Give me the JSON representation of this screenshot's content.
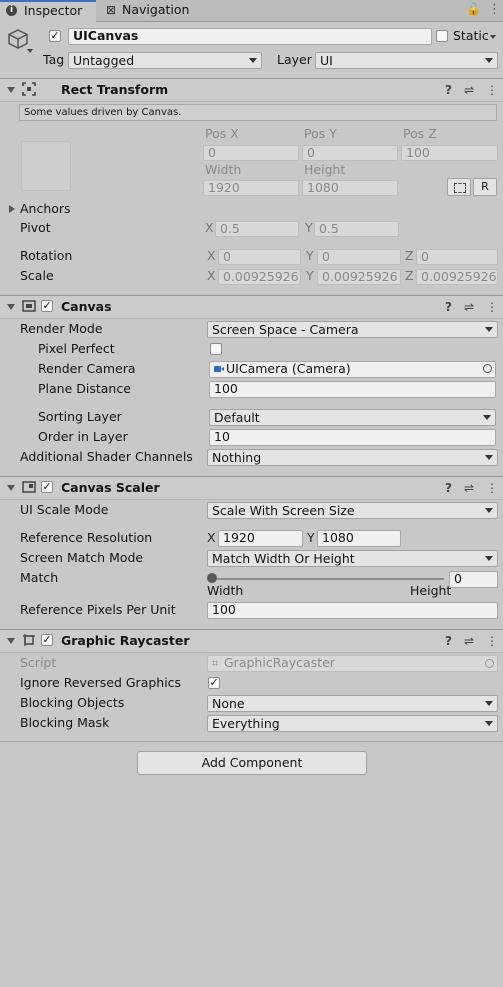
{
  "tabs": {
    "inspector": "Inspector",
    "navigation": "Navigation"
  },
  "object": {
    "name": "UICanvas",
    "static_label": "Static",
    "tag_label": "Tag",
    "tag_value": "Untagged",
    "layer_label": "Layer",
    "layer_value": "UI"
  },
  "rect_transform": {
    "title": "Rect Transform",
    "info": "Some values driven by Canvas.",
    "pos_x_label": "Pos X",
    "pos_y_label": "Pos Y",
    "pos_z_label": "Pos Z",
    "pos_x": "0",
    "pos_y": "0",
    "pos_z": "100",
    "width_label": "Width",
    "height_label": "Height",
    "width": "1920",
    "height": "1080",
    "r_button": "R",
    "anchors_label": "Anchors",
    "pivot_label": "Pivot",
    "pivot_x": "0.5",
    "pivot_y": "0.5",
    "rotation_label": "Rotation",
    "rot_x": "0",
    "rot_y": "0",
    "rot_z": "0",
    "scale_label": "Scale",
    "scale_x": "0.00925926",
    "scale_y": "0.00925926",
    "scale_z": "0.00925926",
    "axis_x": "X",
    "axis_y": "Y",
    "axis_z": "Z"
  },
  "canvas": {
    "title": "Canvas",
    "render_mode_label": "Render Mode",
    "render_mode": "Screen Space - Camera",
    "pixel_perfect_label": "Pixel Perfect",
    "render_camera_label": "Render Camera",
    "render_camera": "UICamera (Camera)",
    "plane_distance_label": "Plane Distance",
    "plane_distance": "100",
    "sorting_layer_label": "Sorting Layer",
    "sorting_layer": "Default",
    "order_label": "Order in Layer",
    "order": "10",
    "shader_channels_label": "Additional Shader Channels",
    "shader_channels": "Nothing"
  },
  "canvas_scaler": {
    "title": "Canvas Scaler",
    "scale_mode_label": "UI Scale Mode",
    "scale_mode": "Scale With Screen Size",
    "ref_res_label": "Reference Resolution",
    "ref_x": "1920",
    "ref_y": "1080",
    "axis_x": "X",
    "axis_y": "Y",
    "match_mode_label": "Screen Match Mode",
    "match_mode": "Match Width Or Height",
    "match_label": "Match",
    "match_value": "0",
    "match_fraction": 0,
    "width_caption": "Width",
    "height_caption": "Height",
    "ppu_label": "Reference Pixels Per Unit",
    "ppu": "100"
  },
  "raycaster": {
    "title": "Graphic Raycaster",
    "script_label": "Script",
    "script": "GraphicRaycaster",
    "ignore_reversed_label": "Ignore Reversed Graphics",
    "blocking_objects_label": "Blocking Objects",
    "blocking_objects": "None",
    "blocking_mask_label": "Blocking Mask",
    "blocking_mask": "Everything"
  },
  "add_component": "Add Component",
  "icons": {
    "help": "?",
    "settings": "⇌",
    "menu": "⋮",
    "check": "✓"
  }
}
